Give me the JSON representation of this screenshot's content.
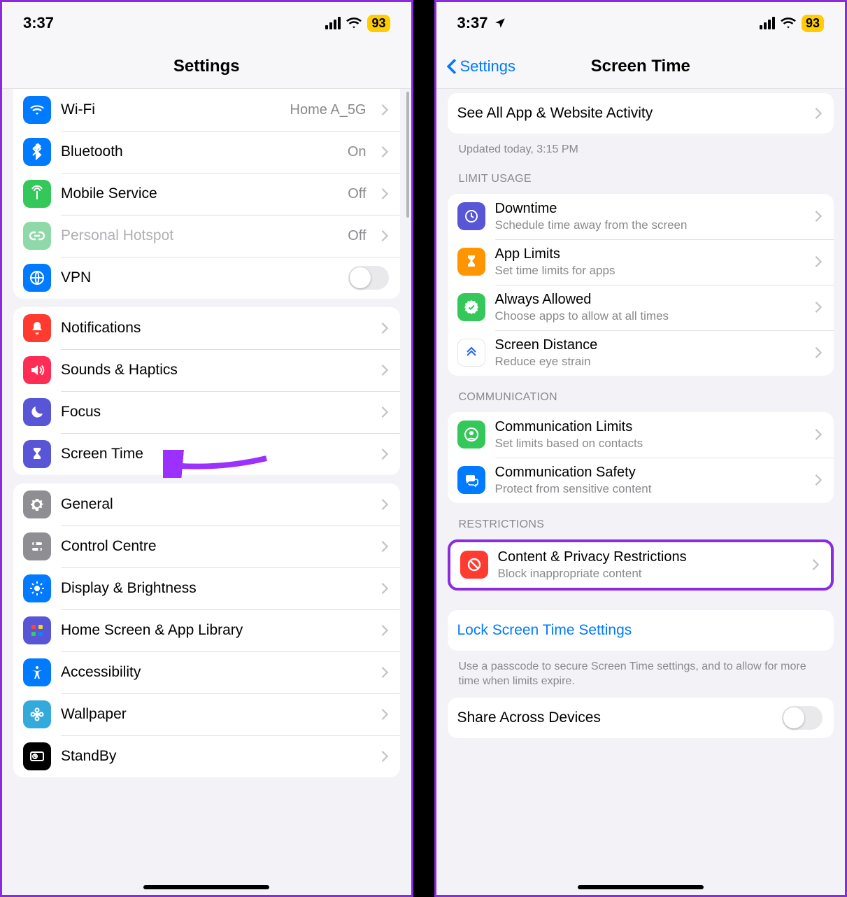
{
  "status": {
    "time": "3:37",
    "battery": "93",
    "location_on_right": true
  },
  "left": {
    "nav_title": "Settings",
    "rows": {
      "wifi": {
        "label": "Wi-Fi",
        "value": "Home A_5G"
      },
      "bt": {
        "label": "Bluetooth",
        "value": "On"
      },
      "cell": {
        "label": "Mobile Service",
        "value": "Off"
      },
      "hotspot": {
        "label": "Personal Hotspot",
        "value": "Off"
      },
      "vpn": {
        "label": "VPN"
      },
      "notif": {
        "label": "Notifications"
      },
      "sounds": {
        "label": "Sounds & Haptics"
      },
      "focus": {
        "label": "Focus"
      },
      "screentime": {
        "label": "Screen Time"
      },
      "general": {
        "label": "General"
      },
      "cc": {
        "label": "Control Centre"
      },
      "display": {
        "label": "Display & Brightness"
      },
      "home": {
        "label": "Home Screen & App Library"
      },
      "acc": {
        "label": "Accessibility"
      },
      "wall": {
        "label": "Wallpaper"
      },
      "standby": {
        "label": "StandBy"
      }
    }
  },
  "right": {
    "back_label": "Settings",
    "nav_title": "Screen Time",
    "activity": {
      "label": "See All App & Website Activity",
      "footer": "Updated today, 3:15 PM"
    },
    "sections": {
      "limit": {
        "header": "Limit Usage"
      },
      "comm": {
        "header": "Communication"
      },
      "restr": {
        "header": "Restrictions"
      }
    },
    "rows": {
      "downtime": {
        "label": "Downtime",
        "sub": "Schedule time away from the screen"
      },
      "applimits": {
        "label": "App Limits",
        "sub": "Set time limits for apps"
      },
      "always": {
        "label": "Always Allowed",
        "sub": "Choose apps to allow at all times"
      },
      "distance": {
        "label": "Screen Distance",
        "sub": "Reduce eye strain"
      },
      "climits": {
        "label": "Communication Limits",
        "sub": "Set limits based on contacts"
      },
      "csafety": {
        "label": "Communication Safety",
        "sub": "Protect from sensitive content"
      },
      "content": {
        "label": "Content & Privacy Restrictions",
        "sub": "Block inappropriate content"
      },
      "lock": {
        "label": "Lock Screen Time Settings"
      },
      "share": {
        "label": "Share Across Devices"
      }
    },
    "lock_footer": "Use a passcode to secure Screen Time settings, and to allow for more time when limits expire."
  }
}
